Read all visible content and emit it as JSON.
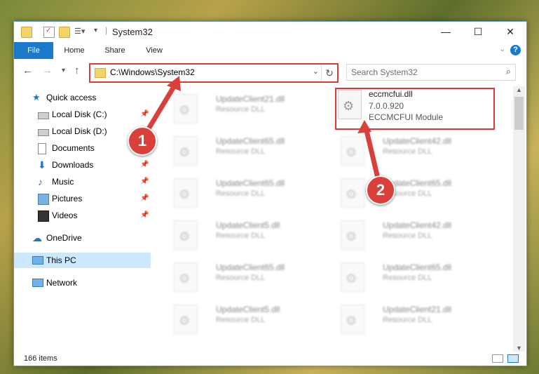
{
  "window": {
    "title": "System32"
  },
  "window_controls": {
    "minimize": "—",
    "maximize": "☐",
    "close": "✕"
  },
  "ribbon": {
    "tabs": [
      "File",
      "Home",
      "Share",
      "View"
    ],
    "help": "?"
  },
  "address": {
    "path": "C:\\Windows\\System32"
  },
  "search": {
    "placeholder": "Search System32"
  },
  "sidebar": {
    "quick_access": "Quick access",
    "items": [
      {
        "label": "Local Disk (C:)",
        "icon": "drive-icon",
        "pinned": true
      },
      {
        "label": "Local Disk (D:)",
        "icon": "drive-icon",
        "pinned": false
      },
      {
        "label": "Documents",
        "icon": "documents-icon",
        "pinned": true
      },
      {
        "label": "Downloads",
        "icon": "download-icon",
        "pinned": true
      },
      {
        "label": "Music",
        "icon": "music-icon",
        "pinned": true
      },
      {
        "label": "Pictures",
        "icon": "pictures-icon",
        "pinned": true
      },
      {
        "label": "Videos",
        "icon": "videos-icon",
        "pinned": true
      }
    ],
    "onedrive": "OneDrive",
    "this_pc": "This PC",
    "network": "Network"
  },
  "files": {
    "highlighted": {
      "name": "eccmcfui.dll",
      "version": "7.0.0.920",
      "description": "ECCMCFUI Module"
    },
    "left_column": [
      {
        "name": "UpdateClient21.dll",
        "type": "Resource DLL"
      },
      {
        "name": "UpdateClient65.dll",
        "type": "Resource DLL"
      },
      {
        "name": "UpdateClient65.dll",
        "type": "Resource DLL"
      },
      {
        "name": "UpdateClient5.dll",
        "type": "Resource DLL"
      },
      {
        "name": "UpdateClient65.dll",
        "type": "Resource DLL"
      },
      {
        "name": "UpdateClient5.dll",
        "type": "Resource DLL"
      }
    ],
    "right_column": [
      {
        "name": "UpdateClient42.dll",
        "type": "Resource DLL"
      },
      {
        "name": "UpdateClient65.dll",
        "type": "Resource DLL"
      },
      {
        "name": "UpdateClient42.dll",
        "type": "Resource DLL"
      },
      {
        "name": "UpdateClient65.dll",
        "type": "Resource DLL"
      },
      {
        "name": "UpdateClient21.dll",
        "type": "Resource DLL"
      }
    ]
  },
  "status": {
    "count": "166 items"
  },
  "annotations": {
    "marker1": "1",
    "marker2": "2"
  },
  "colors": {
    "accent": "#1979ca",
    "highlight": "#d93a3a"
  }
}
